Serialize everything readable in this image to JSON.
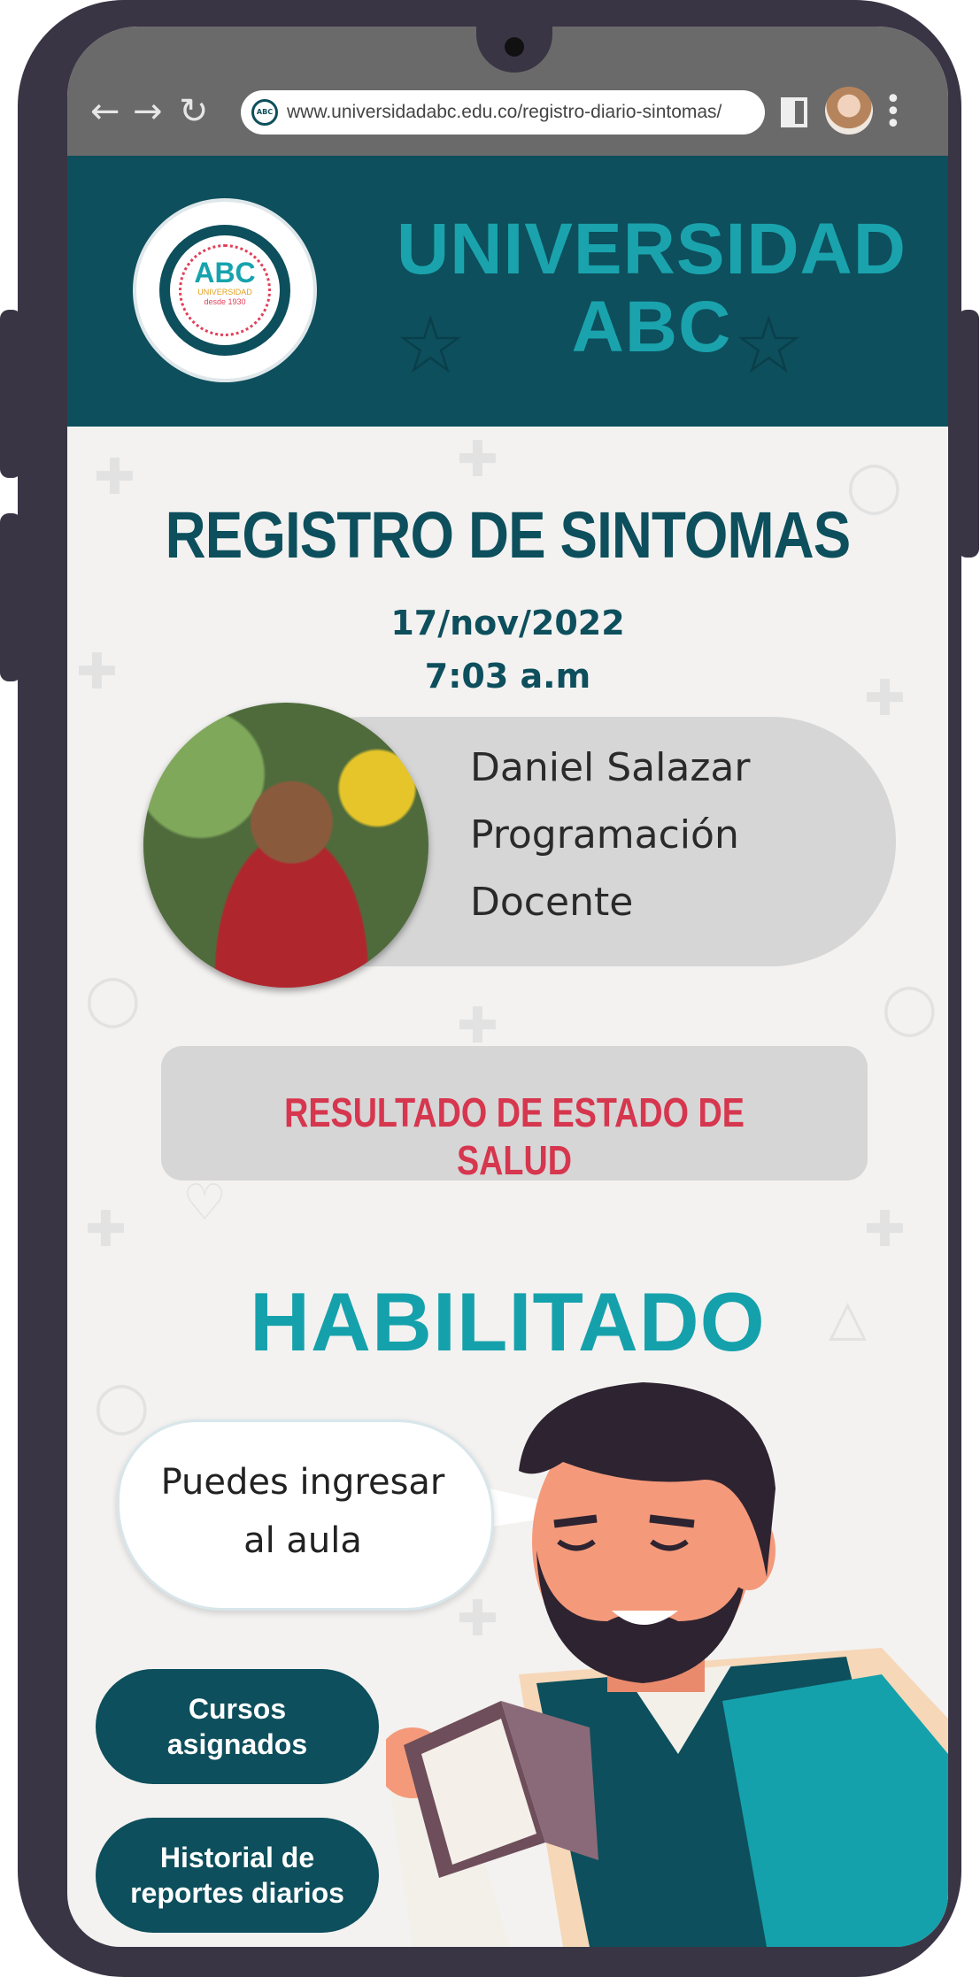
{
  "browser": {
    "url": "www.universidadabc.edu.co/registro-diario-sintomas/",
    "url_logo": "ABC"
  },
  "header": {
    "title_line1": "UNIVERSIDAD",
    "title_line2": "ABC",
    "logo": {
      "text": "ABC",
      "sub1": "UNIVERSIDAD",
      "sub2": "desde 1930"
    }
  },
  "page": {
    "title": "REGISTRO DE SINTOMAS",
    "date": "17/nov/2022",
    "time": "7:03 a.m"
  },
  "profile": {
    "name": "Daniel Salazar",
    "department": "Programación",
    "role": "Docente"
  },
  "status": {
    "label": "RESULTADO DE ESTADO DE SALUD",
    "value": "HABILITADO"
  },
  "message": {
    "line1": "Puedes ingresar",
    "line2": "al aula"
  },
  "buttons": {
    "courses_line1": "Cursos",
    "courses_line2": "asignados",
    "history_line1": "Historial de",
    "history_line2": "reportes diarios"
  },
  "colors": {
    "primary": "#0d4f5c",
    "accent": "#1aa3ad",
    "alert": "#d6364e"
  }
}
